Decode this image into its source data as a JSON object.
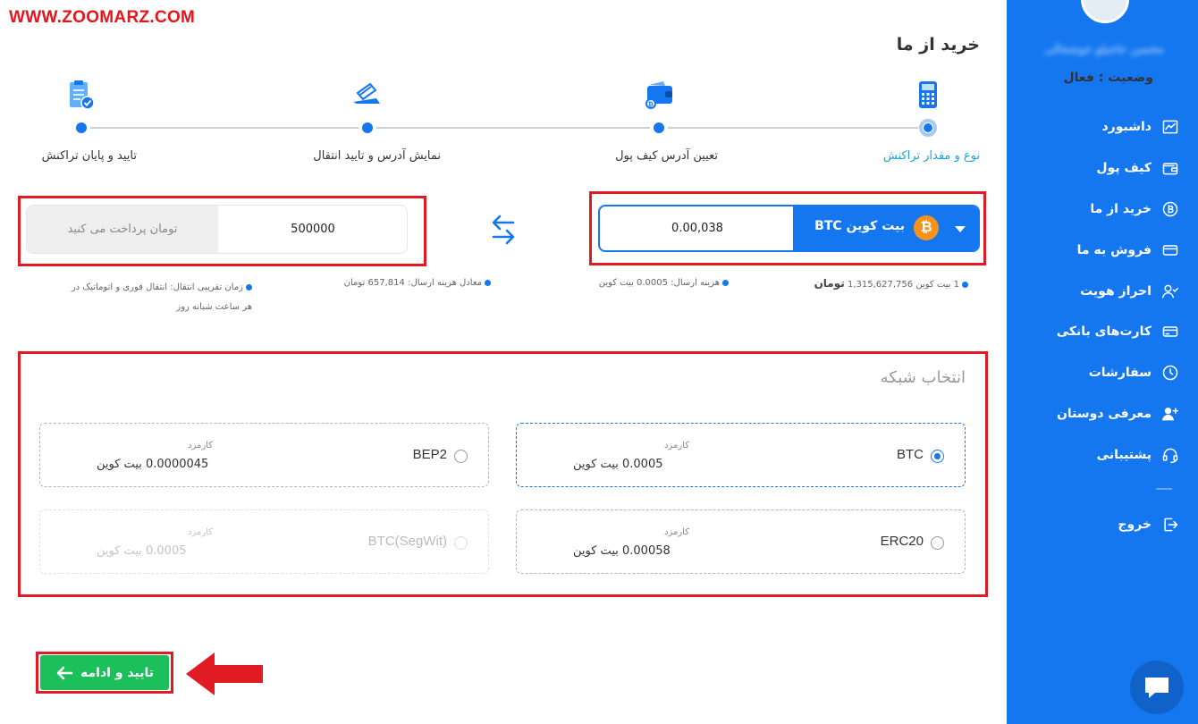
{
  "watermark": "WWW.ZOOMARZ.COM",
  "user": {
    "name": "محسن حاجیلو خوشحالی",
    "status": "وضعیت : فعال"
  },
  "sidebar": {
    "items": [
      {
        "label": "داشبورد",
        "icon": "chart-line-icon"
      },
      {
        "label": "کیف پول",
        "icon": "wallet-icon"
      },
      {
        "label": "خرید از ما",
        "icon": "bitcoin-circle-icon"
      },
      {
        "label": "فروش به ما",
        "icon": "card-icon"
      },
      {
        "label": "احراز هویت",
        "icon": "user-check-icon"
      },
      {
        "label": "کارت‌های بانکی",
        "icon": "bank-card-icon"
      },
      {
        "label": "سفارشات",
        "icon": "clock-icon"
      },
      {
        "label": "معرفی دوستان",
        "icon": "users-add-icon"
      },
      {
        "label": "پشتیبانی",
        "icon": "headset-icon"
      }
    ],
    "logout": {
      "label": "خروج",
      "icon": "logout-icon"
    }
  },
  "page": {
    "title": "خرید از ما"
  },
  "steps": [
    {
      "label": "نوع و مقدار تراکنش",
      "active": true,
      "icon": "calculator-icon"
    },
    {
      "label": "تعیین آدرس کیف پول",
      "active": false,
      "icon": "wallet-bitcoin-icon"
    },
    {
      "label": "نمایش آدرس و تایید انتقال",
      "active": false,
      "icon": "card-transfer-icon"
    },
    {
      "label": "تایید و پایان تراکنش",
      "active": false,
      "icon": "clipboard-check-icon"
    }
  ],
  "crypto": {
    "name": "بیت کوین BTC",
    "amount": "0.00,038",
    "coin_symbol": "₿",
    "coin_color": "#f7931a"
  },
  "toman": {
    "value": "500000",
    "label": "تومان پرداخت می کنید"
  },
  "info": {
    "rate_prefix": "1 بیت کوین 1,315,627,756",
    "rate_unit": "تومان",
    "send_fee": "هزینه ارسال: 0.0005 بیت کوین",
    "fee_equivalent": "معادل هزینه ارسال: 657,814 تومان",
    "time_line1": "زمان تقریبی انتقال: انتقال فوری و اتوماتیک در",
    "time_line2": "هر ساعت شبانه روز"
  },
  "network": {
    "title": "انتخاب شبکه",
    "fee_label": "کارمزد",
    "options": [
      {
        "name": "BTC",
        "fee": "0.0005 بیت کوین",
        "selected": true,
        "disabled": false
      },
      {
        "name": "BEP2",
        "fee": "0.0000045 بیت کوین",
        "selected": false,
        "disabled": false
      },
      {
        "name": "ERC20",
        "fee": "0.00058 بیت کوین",
        "selected": false,
        "disabled": false
      },
      {
        "name": "BTC(SegWit)",
        "fee": "0.0005 بیت کوین",
        "selected": false,
        "disabled": true
      }
    ]
  },
  "actions": {
    "confirm_label": "تایید و ادامه"
  },
  "colors": {
    "primary": "#1477f0",
    "success": "#1cc05b",
    "highlight": "#e11b23",
    "active_step": "#1ca3d8",
    "bitcoin": "#f7931a"
  }
}
